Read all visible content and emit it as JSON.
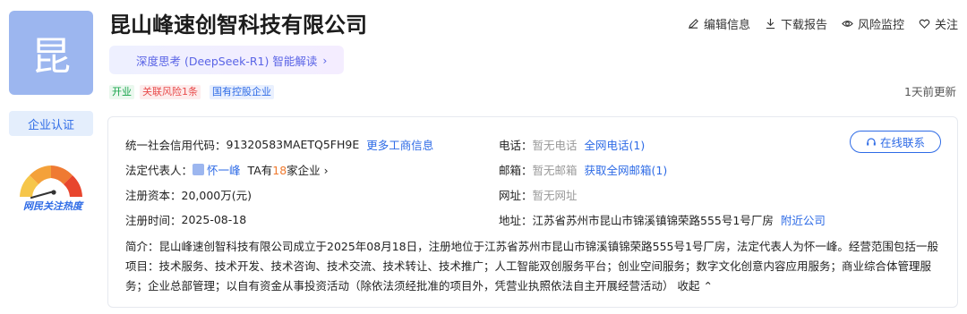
{
  "company": {
    "logo_char": "昆",
    "name": "昆山峰速创智科技有限公司",
    "ai_banner": "深度思考 (DeepSeek-R1) 智能解读",
    "tags": {
      "status": "开业",
      "risk": "关联风险1条",
      "type": "国有控股企业"
    },
    "updated": "1天前更新",
    "verify_label": "企业认证",
    "heat_label": "网民关注热度"
  },
  "actions": {
    "edit": "编辑信息",
    "download": "下载报告",
    "risk": "风险监控",
    "follow": "关注"
  },
  "info": {
    "credit_code_label": "统一社会信用代码：",
    "credit_code": "91320583MAETQ5FH9E",
    "more_link": "更多工商信息",
    "legal_rep_label": "法定代表人：",
    "legal_rep": "怀一峰",
    "ta_prefix": "TA有",
    "ta_count": "18",
    "ta_suffix": "家企业 ›",
    "capital_label": "注册资本：",
    "capital": "20,000万(元)",
    "date_label": "注册时间：",
    "date": "2025-08-18",
    "phone_label": "电话：",
    "phone": "暂无电话",
    "phone_link": "全网电话(1)",
    "email_label": "邮箱：",
    "email": "暂无邮箱",
    "email_link": "获取全网邮箱(1)",
    "website_label": "网址：",
    "website": "暂无网址",
    "address_label": "地址：",
    "address": "江苏省苏州市昆山市锦溪镇锦荣路555号1号厂房",
    "nearby_link": "附近公司",
    "contact_button": "在线联系",
    "intro_text": "简介：昆山峰速创智科技有限公司成立于2025年08月18日，注册地位于江苏省苏州市昆山市锦溪镇锦荣路555号1号厂房，法定代表人为怀一峰。经营范围包括一般项目：技术服务、技术开发、技术咨询、技术交流、技术转让、技术推广；人工智能双创服务平台；创业空间服务；数字文化创意内容应用服务；商业综合体管理服务；企业总部管理；以自有资金从事投资活动（除依法须经批准的项目外，凭营业执照依法自主开展经营活动）",
    "collapse": "收起 ⌃"
  },
  "colors": {
    "accent": "#2e6be6",
    "logo_bg": "#9cb6ef",
    "risk": "#e84b4b",
    "open": "#17a34a"
  }
}
